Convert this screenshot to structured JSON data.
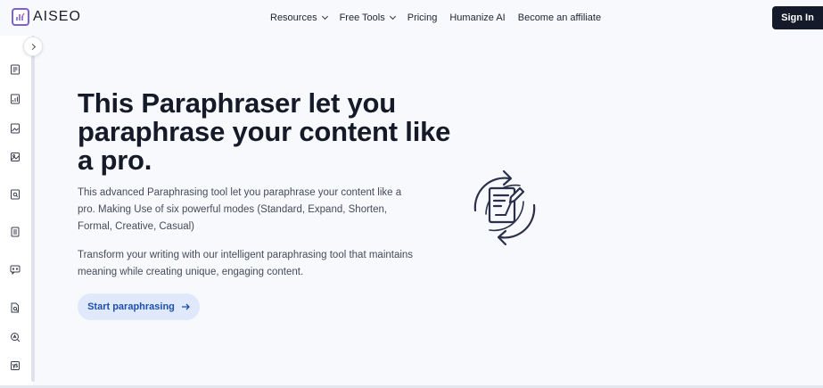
{
  "brand": {
    "name": "AISEO"
  },
  "nav": {
    "items": [
      {
        "label": "Resources",
        "has_dropdown": true
      },
      {
        "label": "Free Tools",
        "has_dropdown": true
      },
      {
        "label": "Pricing",
        "has_dropdown": false
      },
      {
        "label": "Humanize AI",
        "has_dropdown": false
      },
      {
        "label": "Become an affiliate",
        "has_dropdown": false
      }
    ],
    "signin_label": "Sign In"
  },
  "sidebar": {
    "icons": [
      "document-icon",
      "chart-doc-icon",
      "image-doc-icon",
      "image-edit-icon",
      "doc-search-icon",
      "doc-lines-icon",
      "chat-robot-icon",
      "doc-magnify-icon",
      "ai-search-icon",
      "vs-icon"
    ]
  },
  "hero": {
    "title": "This Paraphraser let you paraphrase your content like a pro.",
    "description": "This advanced Paraphrasing tool let you paraphrase your content like a pro. Making Use of six powerful modes (Standard, Expand, Shorten, Formal, Creative, Casual)",
    "description2": "Transform your writing with our intelligent paraphrasing tool that maintains meaning while creating unique, engaging content.",
    "cta_label": "Start paraphrasing"
  },
  "colors": {
    "brand_purple": "#7b61d6",
    "signin_bg": "#141a29",
    "cta_bg": "#dfe9fb",
    "cta_text": "#1d4fb0",
    "illustration_stroke": "#2a2f4a"
  }
}
